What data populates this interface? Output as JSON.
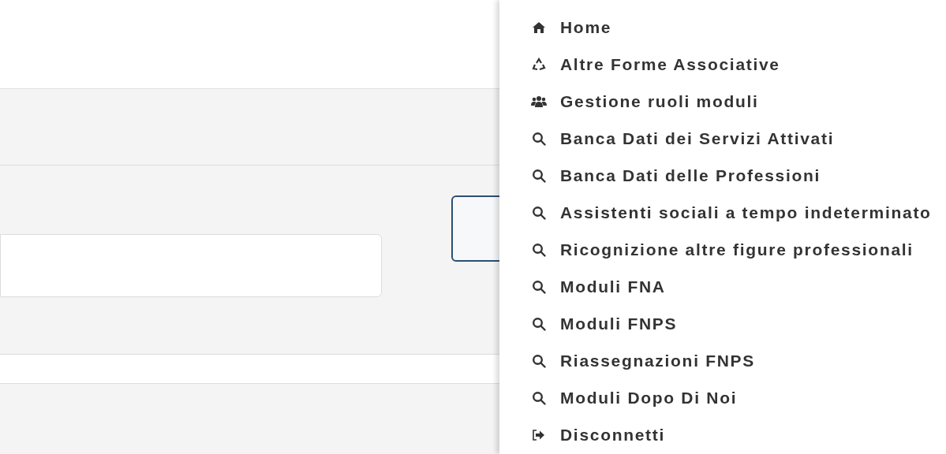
{
  "menu": {
    "items": [
      {
        "kind": "home",
        "label": "Home"
      },
      {
        "kind": "recycle",
        "label": "Altre Forme Associative"
      },
      {
        "kind": "users",
        "label": "Gestione ruoli moduli"
      },
      {
        "kind": "search",
        "label": "Banca Dati dei Servizi Attivati"
      },
      {
        "kind": "search",
        "label": "Banca Dati delle Professioni"
      },
      {
        "kind": "search",
        "label": "Assistenti sociali a tempo indeterminato"
      },
      {
        "kind": "search",
        "label": "Ricognizione altre figure professionali"
      },
      {
        "kind": "search",
        "label": "Moduli FNA"
      },
      {
        "kind": "search",
        "label": "Moduli FNPS"
      },
      {
        "kind": "search",
        "label": "Riassegnazioni FNPS"
      },
      {
        "kind": "search",
        "label": "Moduli Dopo Di Noi"
      },
      {
        "kind": "logout",
        "label": "Disconnetti"
      }
    ]
  }
}
